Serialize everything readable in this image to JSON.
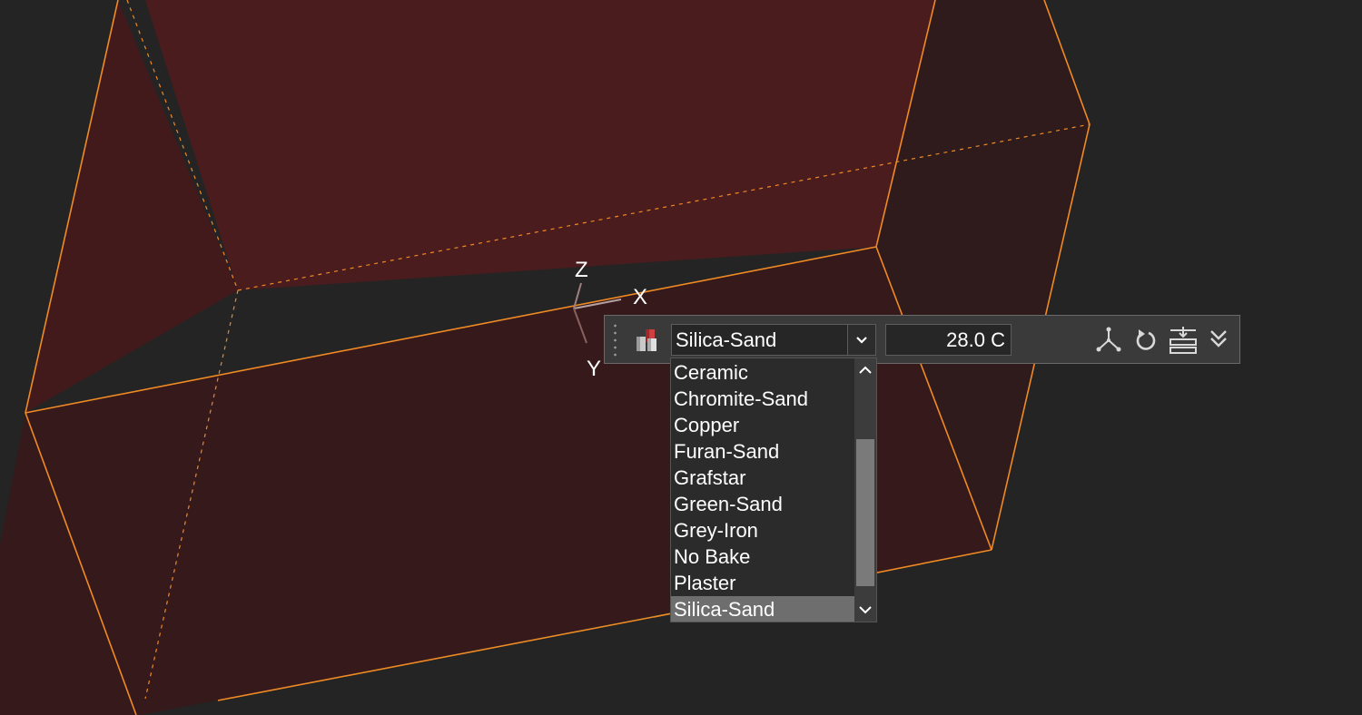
{
  "viewport": {
    "axis_labels": {
      "z": "Z",
      "x": "X",
      "y": "Y"
    }
  },
  "toolbar": {
    "material_combo": {
      "selected": "Silica-Sand"
    },
    "temperature": "28.0 C"
  },
  "dropdown": {
    "items": [
      "Ceramic",
      "Chromite-Sand",
      "Copper",
      "Furan-Sand",
      "Grafstar",
      "Green-Sand",
      "Grey-Iron",
      "No Bake",
      "Plaster",
      "Silica-Sand"
    ],
    "selected": "Silica-Sand"
  },
  "colors": {
    "background": "#242424",
    "box_face": "#4a1c1c",
    "box_edge": "#f08a24",
    "selection": "#6e6e6e"
  },
  "icons": [
    "material-blocks-icon",
    "chevron-down-icon",
    "axis-gizmo-icon",
    "rotate-reset-icon",
    "place-on-plane-icon",
    "double-chevron-down-icon",
    "scroll-up-icon",
    "scroll-down-icon"
  ]
}
